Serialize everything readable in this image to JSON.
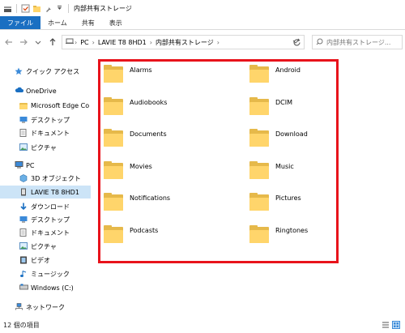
{
  "titlebar": {
    "title": "内部共有ストレージ"
  },
  "ribbon": {
    "tabs": [
      "ファイル",
      "ホーム",
      "共有",
      "表示"
    ]
  },
  "address": {
    "crumbs": [
      "PC",
      "LAVIE T8 8HD1",
      "内部共有ストレージ"
    ],
    "search_placeholder": "内部共有ストレージ..."
  },
  "sidebar": {
    "quick_access": "クイック アクセス",
    "onedrive": "OneDrive",
    "onedrive_items": [
      "Microsoft Edge Co",
      "デスクトップ",
      "ドキュメント",
      "ピクチャ"
    ],
    "pc": "PC",
    "pc_items": [
      "3D オブジェクト",
      "LAVIE T8 8HD1",
      "ダウンロード",
      "デスクトップ",
      "ドキュメント",
      "ピクチャ",
      "ビデオ",
      "ミュージック",
      "Windows (C:)"
    ],
    "network": "ネットワーク"
  },
  "folders": [
    "Alarms",
    "Android",
    "Audiobooks",
    "DCIM",
    "Documents",
    "Download",
    "Movies",
    "Music",
    "Notifications",
    "Pictures",
    "Podcasts",
    "Ringtones"
  ],
  "status": {
    "count": "12 個の項目"
  },
  "colors": {
    "accent": "#1a6fc2",
    "highlight_border": "#e8131b",
    "folder": "#ffd56b",
    "selected": "#cce4f7"
  }
}
